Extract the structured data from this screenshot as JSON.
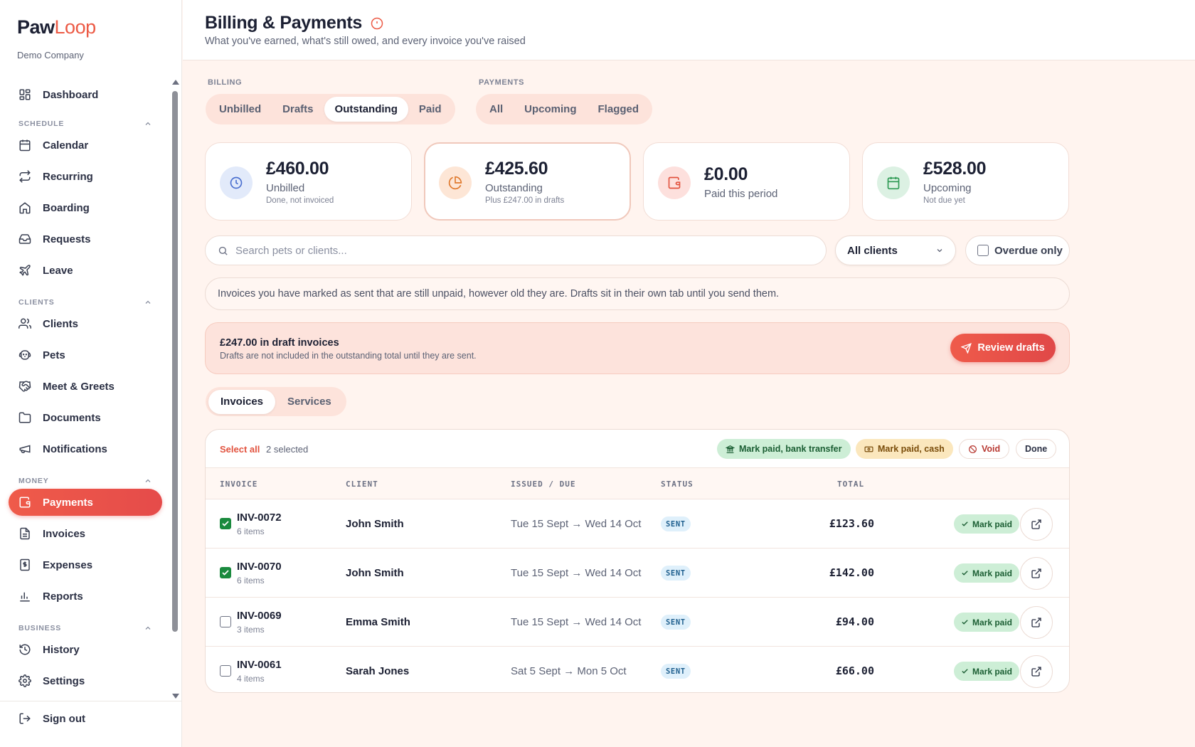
{
  "brand": {
    "name_dark": "Paw",
    "name_accent": "Loop",
    "company": "Demo Company"
  },
  "nav": {
    "dashboard": "Dashboard",
    "schedule_section": "SCHEDULE",
    "calendar": "Calendar",
    "recurring": "Recurring",
    "boarding": "Boarding",
    "requests": "Requests",
    "leave": "Leave",
    "clients_section": "CLIENTS",
    "clients": "Clients",
    "pets": "Pets",
    "meet_greets": "Meet & Greets",
    "documents": "Documents",
    "notifications": "Notifications",
    "money_section": "MONEY",
    "payments": "Payments",
    "invoices": "Invoices",
    "expenses": "Expenses",
    "reports": "Reports",
    "business_section": "BUSINESS",
    "history": "History",
    "settings": "Settings",
    "sign_out": "Sign out"
  },
  "header": {
    "title": "Billing & Payments",
    "subtitle": "What you've earned, what's still owed, and every invoice you've raised"
  },
  "billing": {
    "label": "BILLING",
    "tabs": [
      "Unbilled",
      "Drafts",
      "Outstanding",
      "Paid"
    ],
    "active": "Outstanding"
  },
  "payments_filter": {
    "label": "PAYMENTS",
    "tabs": [
      "All",
      "Upcoming",
      "Flagged"
    ]
  },
  "cards": [
    {
      "value": "£460.00",
      "label": "Unbilled",
      "sub": "Done, not invoiced"
    },
    {
      "value": "£425.60",
      "label": "Outstanding",
      "sub": "Plus £247.00 in drafts"
    },
    {
      "value": "£0.00",
      "label": "Paid this period",
      "sub": ""
    },
    {
      "value": "£528.00",
      "label": "Upcoming",
      "sub": "Not due yet"
    }
  ],
  "search": {
    "placeholder": "Search pets or clients...",
    "value": ""
  },
  "client_filter": {
    "selected": "All clients"
  },
  "overdue_filter": {
    "label": "Overdue only",
    "checked": false
  },
  "info_banner": "Invoices you have marked as sent that are still unpaid, however old they are. Drafts sit in their own tab until you send them.",
  "draft_banner": {
    "title": "£247.00 in draft invoices",
    "subtitle": "Drafts are not included in the outstanding total until they are sent.",
    "button": "Review drafts"
  },
  "sub_tabs": [
    "Invoices",
    "Services"
  ],
  "toolbar": {
    "select_all": "Select all",
    "selected_count": "2 selected",
    "bank_transfer": "Mark paid, bank transfer",
    "cash": "Mark paid, cash",
    "void": "Void",
    "done": "Done"
  },
  "table": {
    "columns": [
      "INVOICE",
      "CLIENT",
      "ISSUED / DUE",
      "STATUS",
      "TOTAL"
    ],
    "rows": [
      {
        "invoice": "INV-0072",
        "items": "6 items",
        "client": "John Smith",
        "dates": "Tue 15 Sept → Wed 14 Oct",
        "status": "SENT",
        "total": "£123.60",
        "checked": true,
        "action": "Mark paid"
      },
      {
        "invoice": "INV-0070",
        "items": "6 items",
        "client": "John Smith",
        "dates": "Tue 15 Sept → Wed 14 Oct",
        "status": "SENT",
        "total": "£142.00",
        "checked": true,
        "action": "Mark paid"
      },
      {
        "invoice": "INV-0069",
        "items": "3 items",
        "client": "Emma Smith",
        "dates": "Tue 15 Sept → Wed 14 Oct",
        "status": "SENT",
        "total": "£94.00",
        "checked": false,
        "action": "Mark paid"
      },
      {
        "invoice": "INV-0061",
        "items": "4 items",
        "client": "Sarah Jones",
        "dates": "Sat 5 Sept → Mon 5 Oct",
        "status": "SENT",
        "total": "£66.00",
        "checked": false,
        "action": "Mark paid"
      }
    ]
  },
  "colors": {
    "accent": "#ec5a45",
    "page_bg": "#fff4ef",
    "success_bg": "#cdeed6",
    "warning_bg": "#fbe7bd",
    "status_bg": "#dff0fb"
  }
}
